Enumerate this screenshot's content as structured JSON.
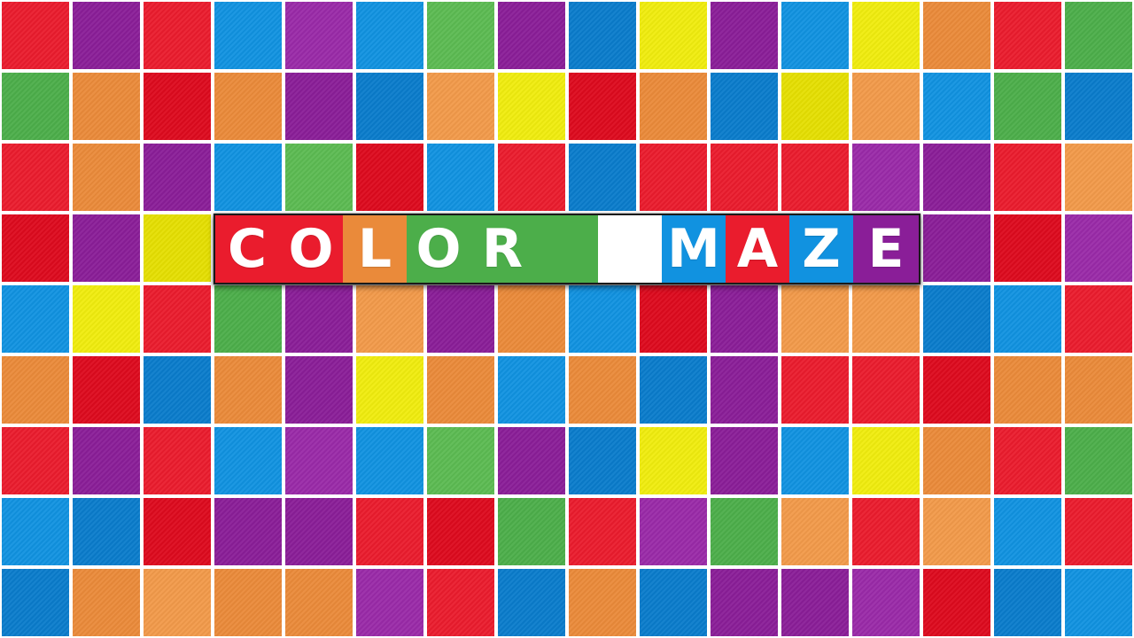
{
  "game": {
    "title_letters": [
      "C",
      "O",
      "L",
      "O",
      "R",
      "",
      "",
      "M",
      "A",
      "Z",
      "E"
    ],
    "title_colors": [
      "red",
      "red",
      "orange",
      "green",
      "green",
      "green",
      "",
      "blue",
      "red",
      "blue",
      "purple"
    ]
  },
  "palette": {
    "red": "#ea1c2d",
    "red2": "#dd0a1e",
    "purple": "#8a1e98",
    "purple2": "#9a2aa8",
    "blue": "#1192e0",
    "blue2": "#0a7ccb",
    "green": "#4cae4a",
    "green2": "#5cbb52",
    "yellow": "#f0ec0e",
    "yellow2": "#e5df02",
    "orange": "#ea8a3a",
    "orange2": "#f29a4a"
  },
  "board": {
    "rows": [
      [
        "red",
        "purple",
        "red",
        "blue",
        "purple2",
        "blue",
        "green2",
        "purple",
        "blue2",
        "yellow",
        "purple",
        "blue",
        "yellow",
        "orange",
        "red",
        "green"
      ],
      [
        "green",
        "orange",
        "red2",
        "orange",
        "purple",
        "blue2",
        "orange2",
        "yellow",
        "red2",
        "orange",
        "blue2",
        "yellow2",
        "orange2",
        "blue",
        "green",
        "blue2"
      ],
      [
        "red",
        "orange",
        "purple",
        "blue",
        "green2",
        "red2",
        "blue",
        "red",
        "blue2",
        "red",
        "red",
        "red",
        "purple2",
        "purple",
        "red",
        "orange2"
      ],
      [
        "red2",
        "purple",
        "yellow2",
        "red",
        "red",
        "orange",
        "green",
        "green",
        "green",
        "blue2",
        "red2",
        "blue",
        "purple",
        "purple",
        "red2",
        "purple2"
      ],
      [
        "blue",
        "yellow",
        "red",
        "green",
        "purple",
        "orange2",
        "purple",
        "orange",
        "blue",
        "red2",
        "purple",
        "orange2",
        "orange2",
        "blue2",
        "blue",
        "red"
      ],
      [
        "orange",
        "red2",
        "blue2",
        "orange",
        "purple",
        "yellow",
        "orange",
        "blue",
        "orange",
        "blue2",
        "purple",
        "red",
        "red",
        "red2",
        "orange",
        "orange"
      ],
      [
        "red",
        "purple",
        "red",
        "blue",
        "purple2",
        "blue",
        "green2",
        "purple",
        "blue2",
        "yellow",
        "purple",
        "blue",
        "yellow",
        "orange",
        "red",
        "green"
      ],
      [
        "blue",
        "blue2",
        "red2",
        "purple",
        "purple",
        "red",
        "red2",
        "green",
        "red",
        "purple2",
        "green",
        "orange2",
        "red",
        "orange2",
        "blue",
        "red"
      ],
      [
        "blue2",
        "orange",
        "orange2",
        "orange",
        "orange",
        "purple2",
        "red",
        "blue2",
        "orange",
        "blue2",
        "purple",
        "purple",
        "purple2",
        "red2",
        "blue2",
        "blue"
      ]
    ]
  }
}
